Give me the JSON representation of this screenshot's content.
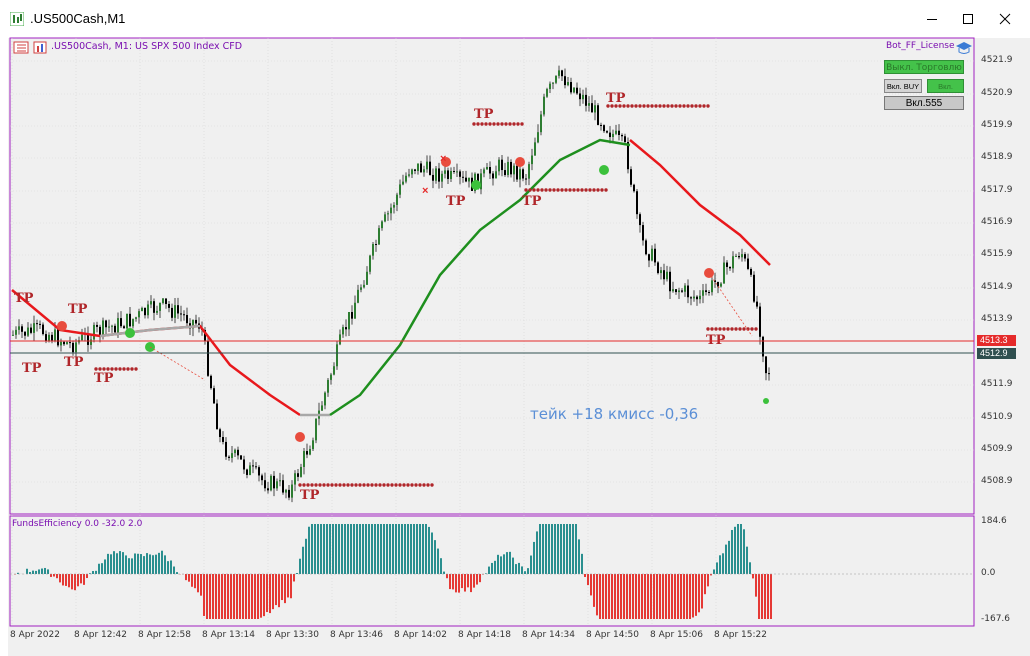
{
  "window": {
    "title": ".US500Cash,M1"
  },
  "chart": {
    "header": ".US500Cash, M1:  US SPX 500 Index CFD",
    "license_label": "Bot_FF_License",
    "buttons": {
      "trade_toggle": "Выкл. Торговлю",
      "buy_toggle": "Вкл. BUY",
      "sell_toggle": "Вкл. SELL",
      "magic": "Вкл.555"
    },
    "annotation": "тейк +18 кмисс -0,36",
    "tp_label": "TP",
    "price_axis": [
      "4521.9",
      "4520.9",
      "4519.9",
      "4518.9",
      "4517.9",
      "4516.9",
      "4515.9",
      "4514.9",
      "4513.9",
      "4511.9",
      "4510.9",
      "4509.9",
      "4508.9"
    ],
    "price_tags": {
      "ask": "4513.3",
      "bid": "4512.9"
    },
    "colors": {
      "bull": "#2e7d32",
      "bear": "#b71c1c",
      "ma_fast": "#e8181c",
      "ma_slow": "#1e8f1e",
      "tp": "#b0262a",
      "accent": "#7a0fb0"
    }
  },
  "subwindow": {
    "title": "FundsEfficiency 0.0 -32.0 2.0",
    "axis": [
      "184.6",
      "0.0",
      "-167.6"
    ]
  },
  "time_axis": [
    "8 Apr 2022",
    "8 Apr 12:42",
    "8 Apr 12:58",
    "8 Apr 13:14",
    "8 Apr 13:30",
    "8 Apr 13:46",
    "8 Apr 14:02",
    "8 Apr 14:18",
    "8 Apr 14:34",
    "8 Apr 14:50",
    "8 Apr 15:06",
    "8 Apr 15:22"
  ]
}
